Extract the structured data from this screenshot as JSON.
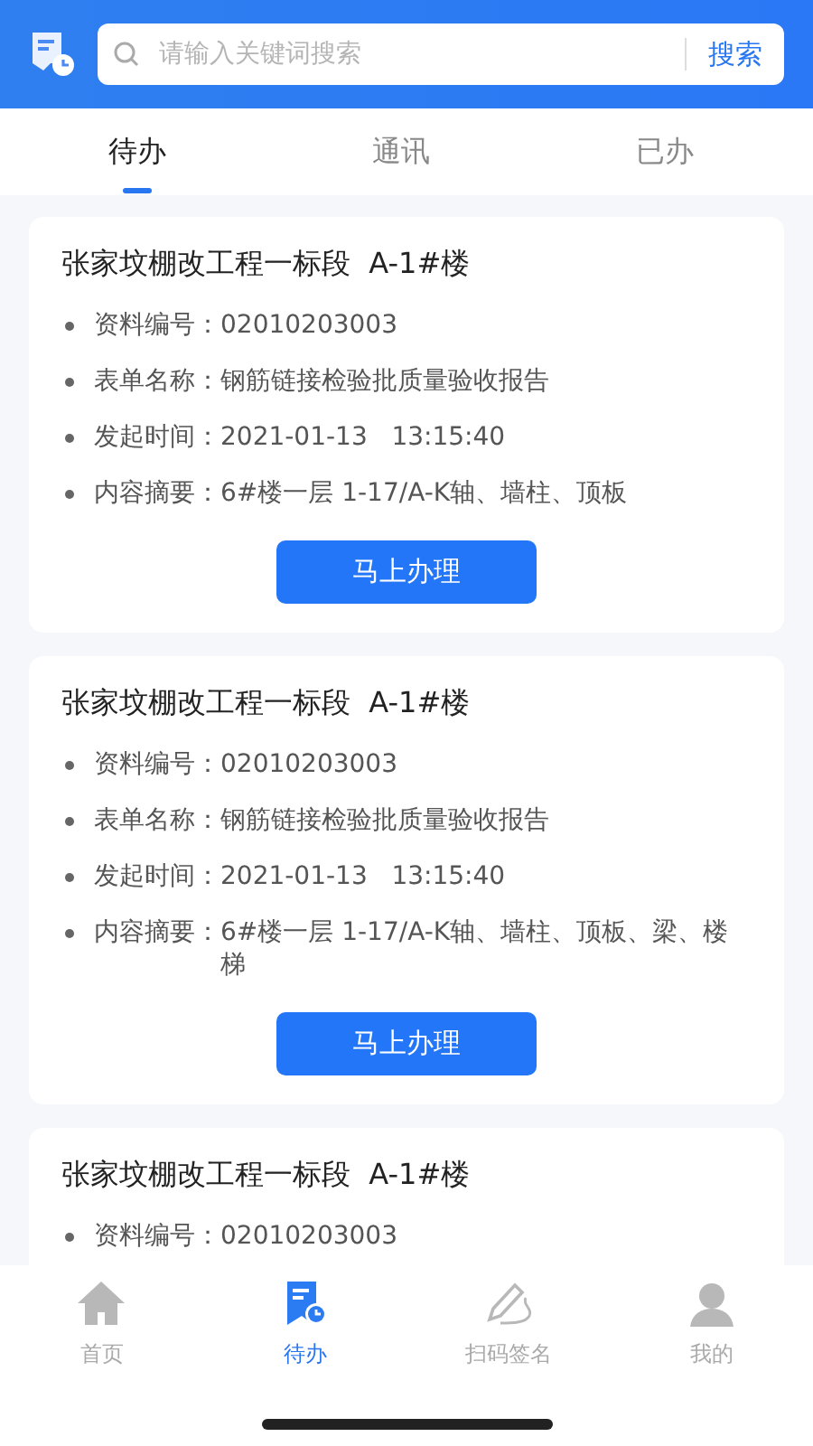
{
  "header": {
    "search": {
      "placeholder": "请输入关键词搜索",
      "button": "搜索"
    }
  },
  "tabs": [
    {
      "label": "待办",
      "selected": true
    },
    {
      "label": "通讯",
      "selected": false
    },
    {
      "label": "已办",
      "selected": false
    }
  ],
  "cards": [
    {
      "title": "张家坟棚改工程一标段  A-1#楼",
      "fields": [
        {
          "label": "资料编号：",
          "value": "02010203003"
        },
        {
          "label": "表单名称：",
          "value": "钢筋链接检验批质量验收报告"
        },
        {
          "label": "发起时间：",
          "value": "2021-01-13   13:15:40"
        },
        {
          "label": "内容摘要：",
          "value": "6#楼一层 1-17/A-K轴、墙柱、顶板"
        }
      ],
      "action": "马上办理"
    },
    {
      "title": "张家坟棚改工程一标段  A-1#楼",
      "fields": [
        {
          "label": "资料编号：",
          "value": "02010203003"
        },
        {
          "label": "表单名称：",
          "value": "钢筋链接检验批质量验收报告"
        },
        {
          "label": "发起时间：",
          "value": "2021-01-13   13:15:40"
        },
        {
          "label": "内容摘要：",
          "value": "6#楼一层 1-17/A-K轴、墙柱、顶板、梁、楼梯"
        }
      ],
      "action": "马上办理"
    },
    {
      "title": "张家坟棚改工程一标段  A-1#楼",
      "fields": [
        {
          "label": "资料编号：",
          "value": "02010203003"
        }
      ]
    }
  ],
  "bottom_nav": [
    {
      "label": "首页",
      "selected": false
    },
    {
      "label": "待办",
      "selected": true
    },
    {
      "label": "扫码签名",
      "selected": false
    },
    {
      "label": "我的",
      "selected": false
    }
  ]
}
